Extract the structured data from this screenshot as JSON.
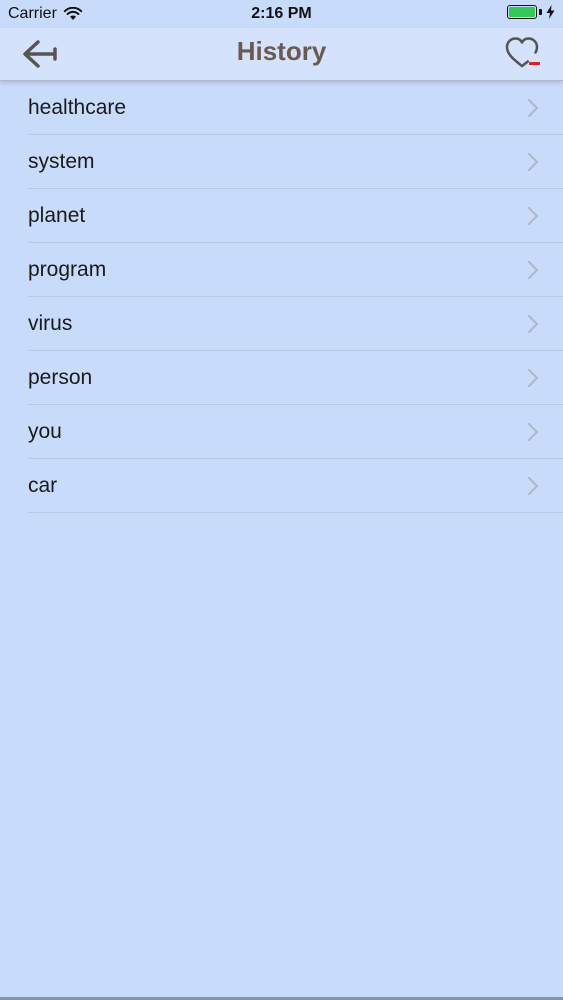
{
  "status_bar": {
    "carrier": "Carrier",
    "time": "2:16 PM",
    "wifi_icon": "wifi-icon",
    "battery_icon": "battery-icon",
    "charging_icon": "bolt-icon"
  },
  "nav": {
    "title": "History",
    "back_icon": "arrow-left-icon",
    "favorite_icon": "heart-minus-icon"
  },
  "colors": {
    "background": "#c9dbfb",
    "title": "#6a5a52",
    "favorite_badge": "#e02020",
    "battery_fill": "#32c85a"
  },
  "history": {
    "items": [
      {
        "label": "healthcare"
      },
      {
        "label": "system"
      },
      {
        "label": "planet"
      },
      {
        "label": "program"
      },
      {
        "label": "virus"
      },
      {
        "label": "person"
      },
      {
        "label": "you"
      },
      {
        "label": "car"
      }
    ]
  }
}
